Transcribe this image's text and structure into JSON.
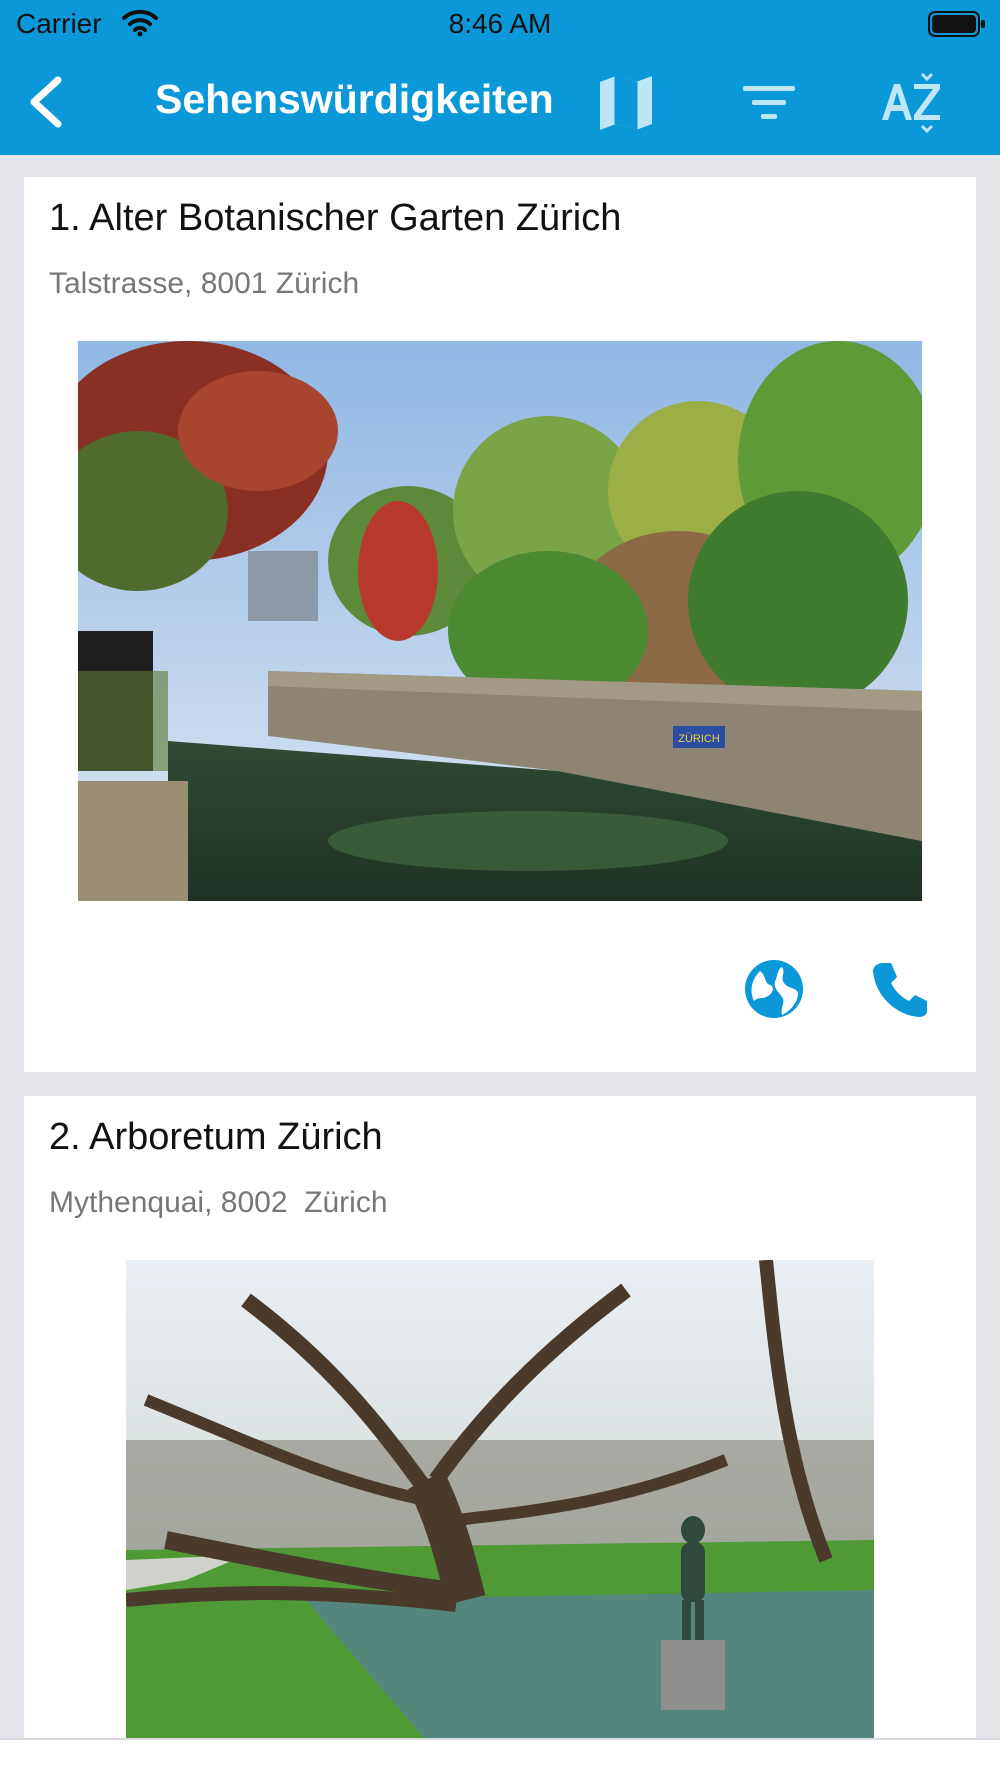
{
  "status_bar": {
    "carrier": "Carrier",
    "time": "8:46 AM"
  },
  "nav": {
    "title": "Sehenswürdigkeiten",
    "back_icon": "chevron-left-icon",
    "map_icon": "map-icon",
    "filter_icon": "filter-icon",
    "sort_icon": "sort-az-icon"
  },
  "colors": {
    "brand": "#0a98d9",
    "background": "#e4e5ea",
    "card": "#ffffff",
    "secondary_text": "#777777"
  },
  "items": [
    {
      "title": "1. Alter Botanischer Garten Zürich",
      "address": "Talstrasse, 8001 Zürich",
      "image_desc": "river canal with stone wall and colorful trees",
      "image_sign": "ZÜRICH",
      "actions": [
        "globe-icon",
        "phone-icon"
      ]
    },
    {
      "title": "2. Arboretum Zürich",
      "address": "Mythenquai, 8002  Zürich",
      "image_desc": "park with large bare tree and bronze statue"
    }
  ]
}
